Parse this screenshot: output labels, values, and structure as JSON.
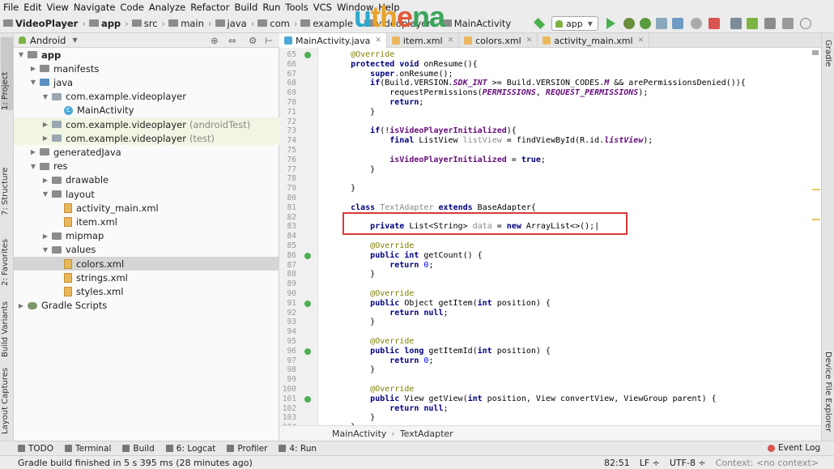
{
  "menu": [
    "File",
    "Edit",
    "View",
    "Navigate",
    "Code",
    "Analyze",
    "Refactor",
    "Build",
    "Run",
    "Tools",
    "VCS",
    "Window",
    "Help"
  ],
  "breadcrumb": [
    {
      "label": "VideoPlayer",
      "bold": true
    },
    {
      "label": "app",
      "bold": true
    },
    {
      "label": "src",
      "bold": false
    },
    {
      "label": "main",
      "bold": false
    },
    {
      "label": "java",
      "bold": false
    },
    {
      "label": "com",
      "bold": false
    },
    {
      "label": "example",
      "bold": false
    },
    {
      "label": "videoplayer",
      "bold": false
    },
    {
      "label": "MainActivity",
      "bold": false
    }
  ],
  "watermark": {
    "p1": "u",
    "p2": "th",
    "p3": "e",
    "p4": "na"
  },
  "toolbar": {
    "run_config": "app"
  },
  "project": {
    "view_selector": "Android",
    "tree": [
      {
        "label": "app",
        "type": "module",
        "depth": 0,
        "arrow": "down",
        "bold": true
      },
      {
        "label": "manifests",
        "type": "folder",
        "depth": 1,
        "arrow": "right"
      },
      {
        "label": "java",
        "type": "folder-blue",
        "depth": 1,
        "arrow": "down"
      },
      {
        "label": "com.example.videoplayer",
        "type": "package",
        "depth": 2,
        "arrow": "down"
      },
      {
        "label": "MainActivity",
        "type": "class",
        "depth": 3,
        "arrow": ""
      },
      {
        "label": "com.example.videoplayer",
        "suffix": "(androidTest)",
        "type": "package",
        "depth": 2,
        "arrow": "right",
        "tinted": true
      },
      {
        "label": "com.example.videoplayer",
        "suffix": "(test)",
        "type": "package",
        "depth": 2,
        "arrow": "right",
        "tinted": true
      },
      {
        "label": "generatedJava",
        "type": "folder",
        "depth": 1,
        "arrow": "right"
      },
      {
        "label": "res",
        "type": "folder",
        "depth": 1,
        "arrow": "down"
      },
      {
        "label": "drawable",
        "type": "folder",
        "depth": 2,
        "arrow": "right"
      },
      {
        "label": "layout",
        "type": "folder",
        "depth": 2,
        "arrow": "down"
      },
      {
        "label": "activity_main.xml",
        "type": "xml",
        "depth": 3,
        "arrow": ""
      },
      {
        "label": "item.xml",
        "type": "xml",
        "depth": 3,
        "arrow": ""
      },
      {
        "label": "mipmap",
        "type": "folder",
        "depth": 2,
        "arrow": "right"
      },
      {
        "label": "values",
        "type": "folder",
        "depth": 2,
        "arrow": "down"
      },
      {
        "label": "colors.xml",
        "type": "xml",
        "depth": 3,
        "arrow": "",
        "selected": true
      },
      {
        "label": "strings.xml",
        "type": "xml",
        "depth": 3,
        "arrow": ""
      },
      {
        "label": "styles.xml",
        "type": "xml",
        "depth": 3,
        "arrow": ""
      },
      {
        "label": "Gradle Scripts",
        "type": "gradle",
        "depth": 0,
        "arrow": "right"
      }
    ]
  },
  "left_stripe": [
    "1: Project",
    "7: Structure",
    "2: Favorites",
    "Build Variants",
    "Layout Captures"
  ],
  "right_stripe": [
    "Gradle",
    "Device File Explorer"
  ],
  "tabs": [
    {
      "label": "MainActivity.java",
      "active": true,
      "color": "#4aa9d8"
    },
    {
      "label": "item.xml",
      "active": false,
      "color": "#e9b85c"
    },
    {
      "label": "colors.xml",
      "active": false,
      "color": "#e9b85c"
    },
    {
      "label": "activity_main.xml",
      "active": false,
      "color": "#e9b85c"
    }
  ],
  "editor": {
    "lines": [
      {
        "n": "65",
        "html": "    <span class='an'>@Override</span>",
        "mark": true
      },
      {
        "n": "66",
        "html": "    <span class='kw'>protected void</span> onResume(){"
      },
      {
        "n": "67",
        "html": "        <span class='kw'>super</span>.onResume();"
      },
      {
        "n": "68",
        "html": "        <span class='kw'>if</span>(Build.VERSION.<span class='fld'>SDK_INT</span> >= Build.VERSION_CODES.<span class='fld'>M</span> &amp;&amp; arePermissionsDenied()){"
      },
      {
        "n": "69",
        "html": "            requestPermissions(<span class='fld'>PERMISSIONS</span>, <span class='fld'>REQUEST_PERMISSIONS</span>);"
      },
      {
        "n": "70",
        "html": "            <span class='kw'>return</span>;"
      },
      {
        "n": "71",
        "html": "        }"
      },
      {
        "n": "72",
        "html": ""
      },
      {
        "n": "73",
        "html": "        <span class='kw'>if</span>(!<span class='fldb'>isVideoPlayerInitialized</span>){"
      },
      {
        "n": "74",
        "html": "            <span class='kw'>final</span> ListView <span class='gr'>listView</span> = findViewById(R.id.<span class='fld'>listView</span>);"
      },
      {
        "n": "75",
        "html": ""
      },
      {
        "n": "76",
        "html": "            <span class='fldb'>isVideoPlayerInitialized</span> = <span class='kw'>true</span>;"
      },
      {
        "n": "77",
        "html": "        }"
      },
      {
        "n": "78",
        "html": ""
      },
      {
        "n": "79",
        "html": "    }"
      },
      {
        "n": "80",
        "html": ""
      },
      {
        "n": "81",
        "html": "    <span class='kw'>class</span> <span class='gr'>TextAdapter</span> <span class='kw'>extends</span> BaseAdapter{"
      },
      {
        "n": "82",
        "html": ""
      },
      {
        "n": "83",
        "html": "        <span class='kw'>private</span> List&lt;String&gt; <span class='gr'>data</span> = <span class='kw'>new</span> ArrayList&lt;&gt;();|",
        "current": true
      },
      {
        "n": "84",
        "html": ""
      },
      {
        "n": "85",
        "html": "        <span class='an'>@Override</span>"
      },
      {
        "n": "86",
        "html": "        <span class='kw'>public int</span> getCount() {",
        "mark": true
      },
      {
        "n": "87",
        "html": "            <span class='kw'>return</span> <span class='num'>0</span>;"
      },
      {
        "n": "88",
        "html": "        }"
      },
      {
        "n": "89",
        "html": ""
      },
      {
        "n": "90",
        "html": "        <span class='an'>@Override</span>"
      },
      {
        "n": "91",
        "html": "        <span class='kw'>public</span> Object getItem(<span class='kw'>int</span> position) {",
        "mark": true
      },
      {
        "n": "92",
        "html": "            <span class='kw'>return null</span>;"
      },
      {
        "n": "93",
        "html": "        }"
      },
      {
        "n": "94",
        "html": ""
      },
      {
        "n": "95",
        "html": "        <span class='an'>@Override</span>"
      },
      {
        "n": "96",
        "html": "        <span class='kw'>public long</span> getItemId(<span class='kw'>int</span> position) {",
        "mark": true
      },
      {
        "n": "97",
        "html": "            <span class='kw'>return</span> <span class='num'>0</span>;"
      },
      {
        "n": "98",
        "html": "        }"
      },
      {
        "n": "99",
        "html": ""
      },
      {
        "n": "100",
        "html": "        <span class='an'>@Override</span>"
      },
      {
        "n": "101",
        "html": "        <span class='kw'>public</span> View getView(<span class='kw'>int</span> position, View convertView, ViewGroup parent) {",
        "mark": true
      },
      {
        "n": "102",
        "html": "            <span class='kw'>return null</span>;"
      },
      {
        "n": "103",
        "html": "        }"
      },
      {
        "n": "104",
        "html": "    }"
      }
    ],
    "footer": [
      "MainActivity",
      "TextAdapter"
    ]
  },
  "tool_windows": [
    {
      "label": "TODO",
      "key": ""
    },
    {
      "label": "Terminal",
      "key": ""
    },
    {
      "label": "Build",
      "key": ""
    },
    {
      "label": "6: Logcat",
      "key": "6"
    },
    {
      "label": "Profiler",
      "key": ""
    },
    {
      "label": "4: Run",
      "key": "4"
    }
  ],
  "event_log": "Event Log",
  "status": {
    "message": "Gradle build finished in 5 s 395 ms (28 minutes ago)",
    "position": "82:51",
    "line_sep": "LF ÷",
    "encoding": "UTF-8 ÷",
    "context": "Context: <no context>"
  }
}
